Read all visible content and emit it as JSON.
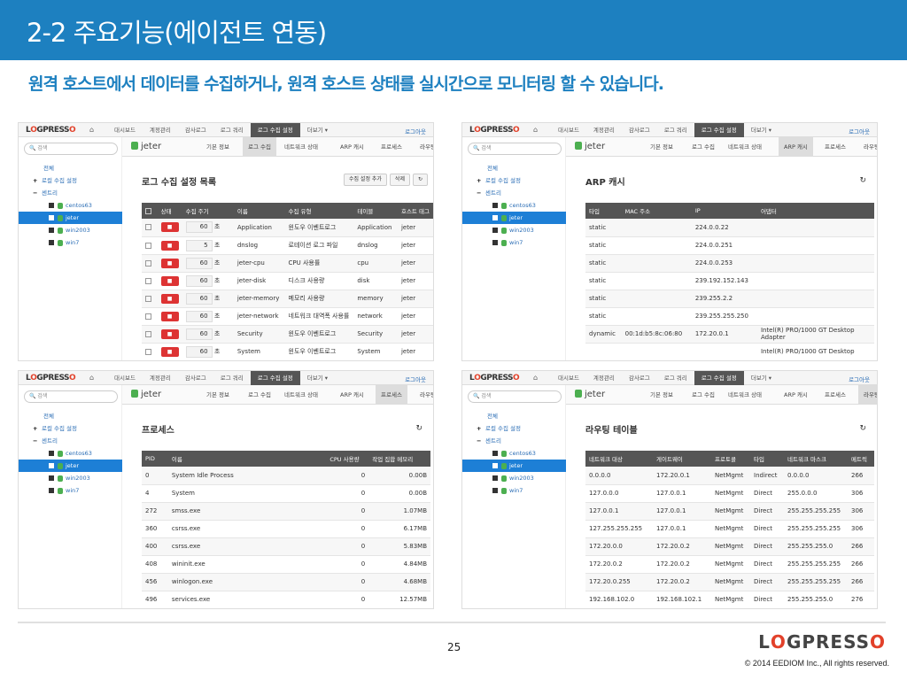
{
  "slide": {
    "title": "2-2 주요기능(에이전트 연동)",
    "subtitle": "원격 호스트에서 데이터를 수집하거나, 원격 호스트 상태를 실시간으로 모니터링 할 수 있습니다.",
    "page_number": "25",
    "copyright": "© 2014 EEDIOM Inc., All rights reserved.",
    "footer_logo": "LOGPRESSO"
  },
  "app": {
    "logo": "LOGPRESSO",
    "home_icon": "home-icon",
    "nav": [
      "대시보드",
      "계정관리",
      "감사로그",
      "로그 쿼리",
      "로그 수집 설정",
      "더보기 ▾"
    ],
    "active_nav": "로그 수집 설정",
    "logout": "로그아웃",
    "search_placeholder": "검색",
    "tree": {
      "root": "전체",
      "agent_group": "로컬 수집 설정",
      "sensor_group": "센트리",
      "hosts": [
        "centos63",
        "jeter",
        "win2003",
        "win7"
      ],
      "selected": "jeter"
    },
    "host": "jeter",
    "tabs": [
      "기본 정보",
      "로그 수집",
      "네트워크 상태",
      "ARP 캐시",
      "프로세스",
      "라우팅 테이블"
    ]
  },
  "panels": {
    "log_collect": {
      "active_tab": "로그 수집",
      "title": "로그 수집 설정 목록",
      "add_button": "수집 설정 추가",
      "delete_button": "삭제",
      "columns": [
        "상태",
        "수집 주기",
        "이름",
        "수집 유형",
        "테이블",
        "호스트 태그"
      ],
      "unit": "초",
      "stop_label": "■",
      "rows": [
        [
          "60",
          "Application",
          "윈도우 이벤트로그",
          "Application",
          "jeter"
        ],
        [
          "5",
          "dnslog",
          "로테이션 로그 파일",
          "dnslog",
          "jeter"
        ],
        [
          "60",
          "jeter-cpu",
          "CPU 사용률",
          "cpu",
          "jeter"
        ],
        [
          "60",
          "jeter-disk",
          "디스크 사용량",
          "disk",
          "jeter"
        ],
        [
          "60",
          "jeter-memory",
          "메모리 사용량",
          "memory",
          "jeter"
        ],
        [
          "60",
          "jeter-network",
          "네트워크 대역폭 사용률",
          "network",
          "jeter"
        ],
        [
          "60",
          "Security",
          "윈도우 이벤트로그",
          "Security",
          "jeter"
        ],
        [
          "60",
          "System",
          "윈도우 이벤트로그",
          "System",
          "jeter"
        ]
      ]
    },
    "arp": {
      "active_tab": "ARP 캐시",
      "title": "ARP 캐시",
      "columns": [
        "타입",
        "MAC 주소",
        "IP",
        "어댑터"
      ],
      "rows": [
        [
          "static",
          "",
          "224.0.0.22",
          ""
        ],
        [
          "static",
          "",
          "224.0.0.251",
          ""
        ],
        [
          "static",
          "",
          "224.0.0.253",
          ""
        ],
        [
          "static",
          "",
          "239.192.152.143",
          ""
        ],
        [
          "static",
          "",
          "239.255.2.2",
          ""
        ],
        [
          "static",
          "",
          "239.255.255.250",
          ""
        ],
        [
          "dynamic",
          "00:1d:b5:8c:06:80",
          "172.20.0.1",
          "Intel(R) PRO/1000 GT Desktop Adapter"
        ],
        [
          "",
          "",
          "",
          "Intel(R) PRO/1000 GT Desktop"
        ]
      ]
    },
    "process": {
      "active_tab": "프로세스",
      "title": "프로세스",
      "columns": [
        "PID",
        "이름",
        "CPU 사용량",
        "작업 집합 메모리"
      ],
      "rows": [
        [
          "0",
          "System Idle Process",
          "0",
          "0.00B"
        ],
        [
          "4",
          "System",
          "0",
          "0.00B"
        ],
        [
          "272",
          "smss.exe",
          "0",
          "1.07MB"
        ],
        [
          "360",
          "csrss.exe",
          "0",
          "6.17MB"
        ],
        [
          "400",
          "csrss.exe",
          "0",
          "5.83MB"
        ],
        [
          "408",
          "wininit.exe",
          "0",
          "4.84MB"
        ],
        [
          "456",
          "winlogon.exe",
          "0",
          "4.68MB"
        ],
        [
          "496",
          "services.exe",
          "0",
          "12.57MB"
        ]
      ]
    },
    "routing": {
      "active_tab": "라우팅 테이블",
      "title": "라우팅 테이블",
      "columns": [
        "네트워크 대상",
        "게이트웨이",
        "프로토콜",
        "타입",
        "네트워크 마스크",
        "메트릭"
      ],
      "rows": [
        [
          "0.0.0.0",
          "172.20.0.1",
          "NetMgmt",
          "Indirect",
          "0.0.0.0",
          "266"
        ],
        [
          "127.0.0.0",
          "127.0.0.1",
          "NetMgmt",
          "Direct",
          "255.0.0.0",
          "306"
        ],
        [
          "127.0.0.1",
          "127.0.0.1",
          "NetMgmt",
          "Direct",
          "255.255.255.255",
          "306"
        ],
        [
          "127.255.255.255",
          "127.0.0.1",
          "NetMgmt",
          "Direct",
          "255.255.255.255",
          "306"
        ],
        [
          "172.20.0.0",
          "172.20.0.2",
          "NetMgmt",
          "Direct",
          "255.255.255.0",
          "266"
        ],
        [
          "172.20.0.2",
          "172.20.0.2",
          "NetMgmt",
          "Direct",
          "255.255.255.255",
          "266"
        ],
        [
          "172.20.0.255",
          "172.20.0.2",
          "NetMgmt",
          "Direct",
          "255.255.255.255",
          "266"
        ],
        [
          "192.168.102.0",
          "192.168.102.1",
          "NetMgmt",
          "Direct",
          "255.255.255.0",
          "276"
        ]
      ]
    }
  }
}
